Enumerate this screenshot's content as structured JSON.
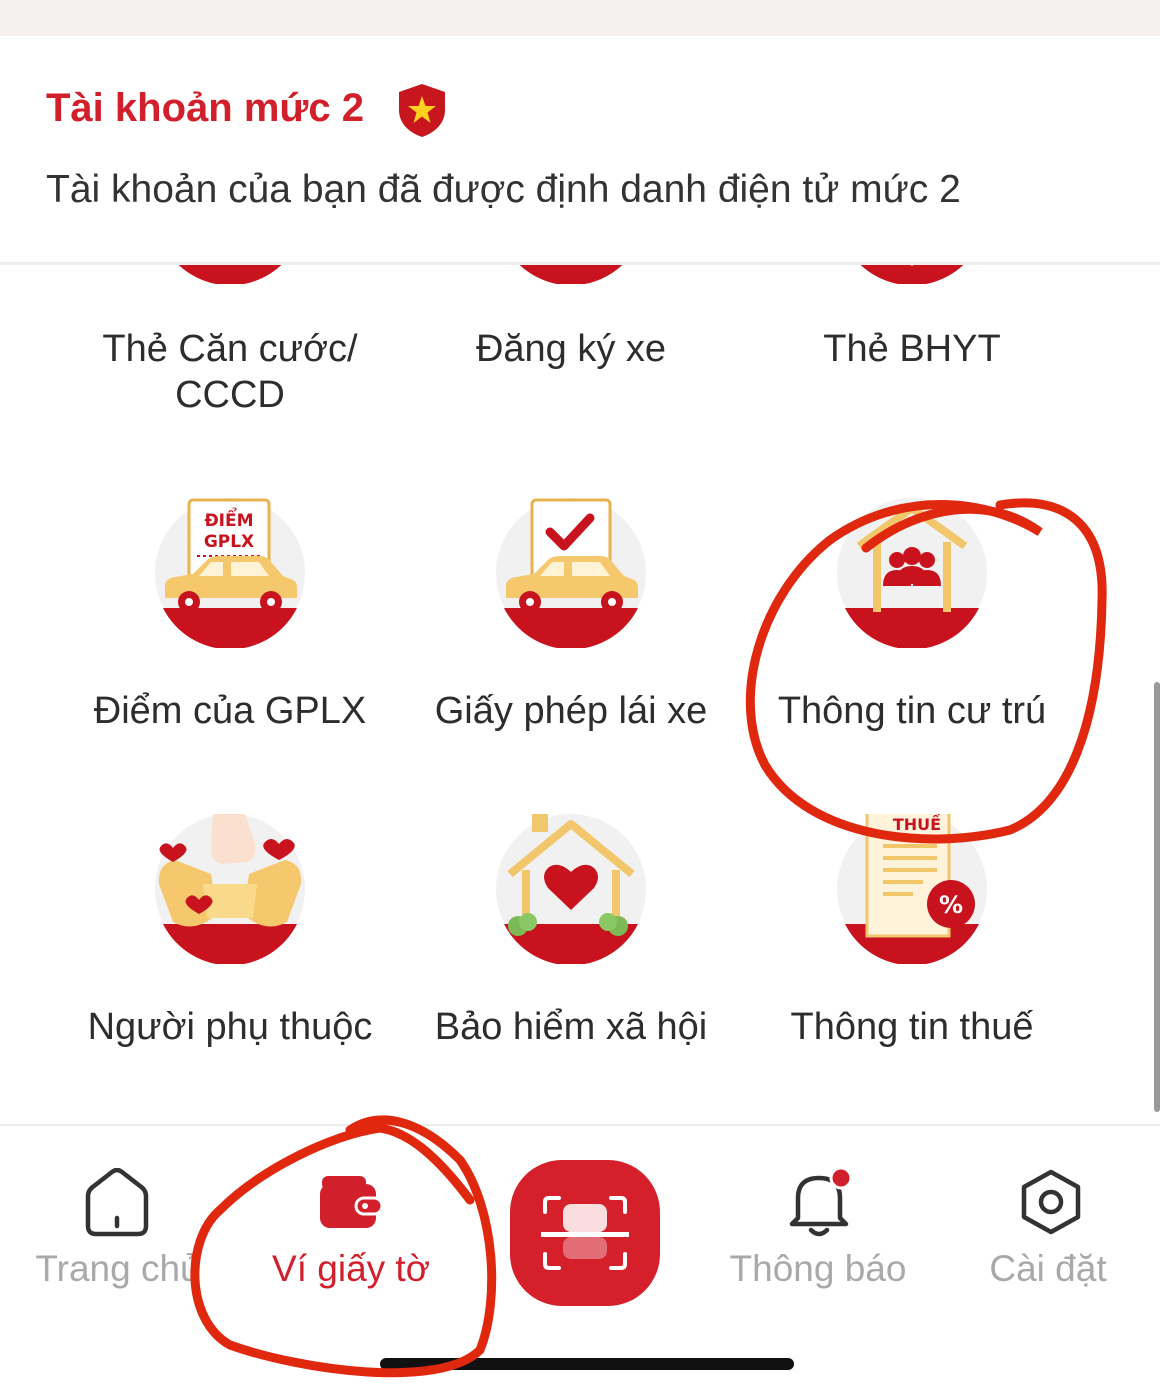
{
  "account": {
    "title": "Tài khoản mức 2",
    "description": "Tài khoản của bạn đã được định danh điện tử mức 2"
  },
  "documents": [
    {
      "label": "Thẻ Căn cước/ CCCD",
      "icon": "id-card-icon"
    },
    {
      "label": "Đăng ký xe",
      "icon": "vehicle-registration-icon"
    },
    {
      "label": "Thẻ BHYT",
      "icon": "health-insurance-icon"
    },
    {
      "label": "Điểm của GPLX",
      "icon": "license-points-icon",
      "icon_text_line1": "ĐIỂM",
      "icon_text_line2": "GPLX"
    },
    {
      "label": "Giấy phép lái xe",
      "icon": "driving-license-icon"
    },
    {
      "label": "Thông tin cư trú",
      "icon": "residence-info-icon"
    },
    {
      "label": "Người phụ thuộc",
      "icon": "dependents-icon"
    },
    {
      "label": "Bảo hiểm xã hội",
      "icon": "social-insurance-icon"
    },
    {
      "label": "Thông tin thuế",
      "icon": "tax-info-icon",
      "icon_text": "THUẾ"
    }
  ],
  "tabbar": {
    "home": "Trang chủ",
    "wallet": "Ví giấy tờ",
    "notifications": "Thông báo",
    "settings": "Cài đặt",
    "active": "wallet"
  },
  "colors": {
    "brand_red": "#d1202b",
    "inactive_gray": "#a9a9a9",
    "annotation_red": "#e0280f"
  }
}
